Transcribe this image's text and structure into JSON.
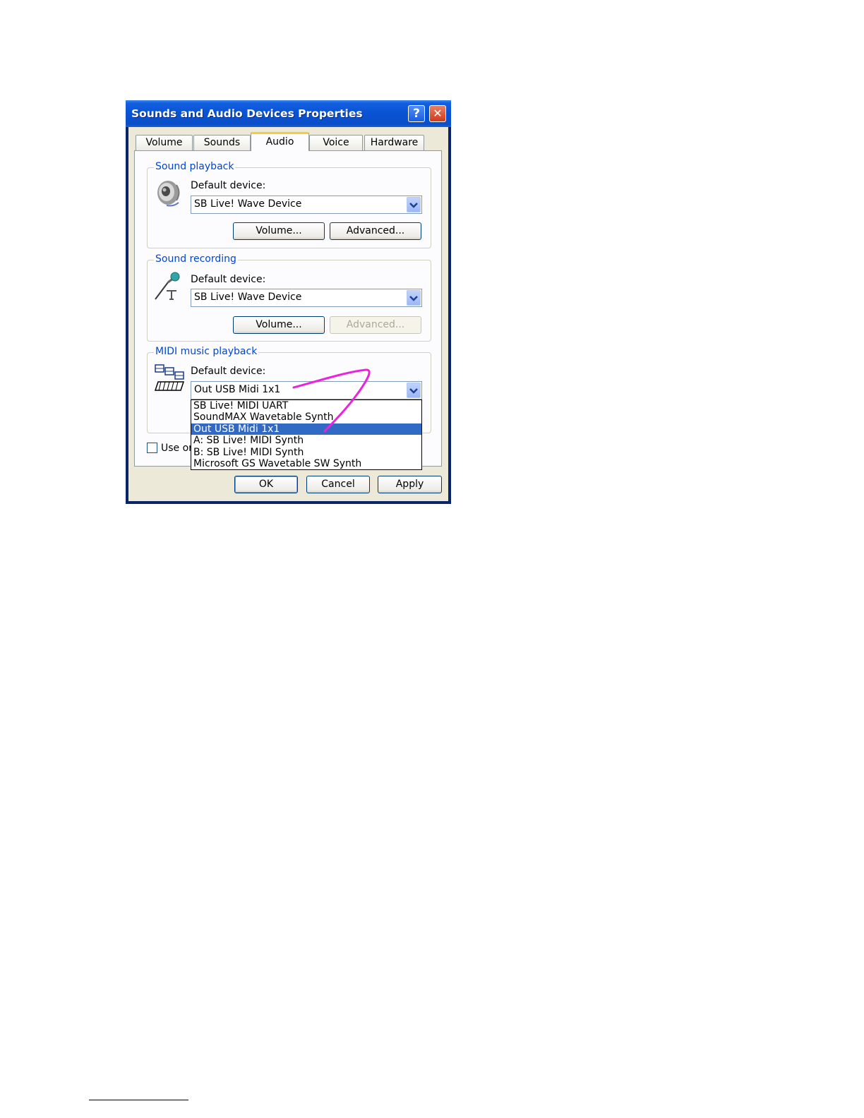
{
  "window": {
    "title": "Sounds and Audio Devices Properties",
    "help_glyph": "?",
    "close_glyph": "✕"
  },
  "tabs": [
    {
      "label": "Volume"
    },
    {
      "label": "Sounds"
    },
    {
      "label": "Audio",
      "active": true
    },
    {
      "label": "Voice"
    },
    {
      "label": "Hardware"
    }
  ],
  "sound_playback": {
    "legend": "Sound playback",
    "default_device_label": "Default device:",
    "device": "SB Live! Wave Device",
    "volume_button": "Volume...",
    "advanced_button": "Advanced..."
  },
  "sound_recording": {
    "legend": "Sound recording",
    "default_device_label": "Default device:",
    "device": "SB Live! Wave Device",
    "volume_button": "Volume...",
    "advanced_button": "Advanced..."
  },
  "midi_playback": {
    "legend": "MIDI music playback",
    "default_device_label": "Default device:",
    "device": "Out USB Midi 1x1",
    "options": [
      "SB Live! MIDI UART",
      "SoundMAX Wavetable Synth",
      "Out USB Midi 1x1",
      "A: SB Live! MIDI Synth",
      "B: SB Live! MIDI Synth",
      "Microsoft GS Wavetable SW Synth"
    ],
    "selected_index": 2
  },
  "checkbox": {
    "label": "Use or",
    "checked": false
  },
  "buttons": {
    "ok": "OK",
    "cancel": "Cancel",
    "apply": "Apply"
  },
  "annotation_color": "#ee22dd",
  "icons": [
    "speaker-icon",
    "microphone-icon",
    "midi-keyboard-icon"
  ]
}
